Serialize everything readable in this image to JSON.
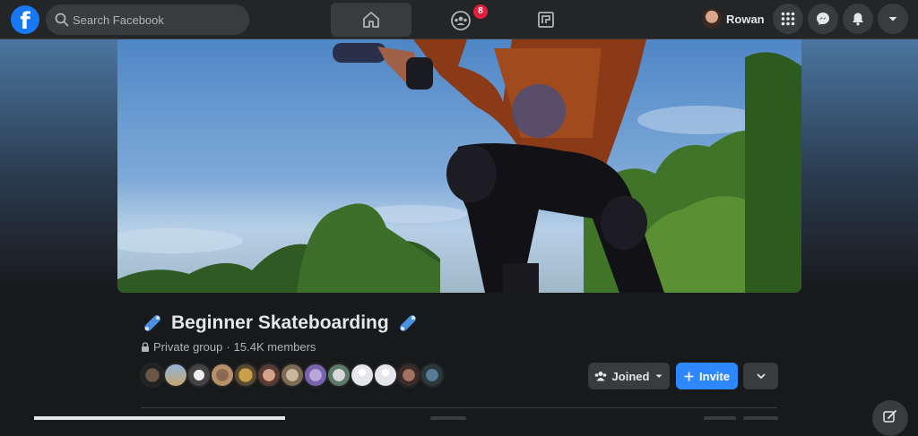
{
  "nav": {
    "search_placeholder": "Search Facebook",
    "groups_badge": "8",
    "profile_name": "Rowan",
    "icons": [
      "facebook-logo",
      "search-icon",
      "home-icon",
      "groups-icon",
      "gaming-icon",
      "menu-grid-icon",
      "messenger-icon",
      "bell-icon",
      "caret-down-icon"
    ]
  },
  "group": {
    "title": "Beginner Skateboarding",
    "privacy_label": "Private group",
    "members_label": "15.4K members",
    "separator": "·",
    "member_avatar_count": 13
  },
  "actions": {
    "joined_label": "Joined",
    "invite_label": "Invite"
  },
  "colors": {
    "brand": "#1877f2",
    "primary_button": "#2d88ff",
    "badge": "#e41e3f",
    "surface": "#242526",
    "background": "#18191a"
  }
}
